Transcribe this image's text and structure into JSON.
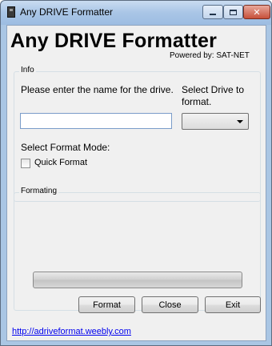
{
  "window": {
    "title": "Any DRIVE Formatter",
    "icon": "usb-drive-icon"
  },
  "header": {
    "app_title": "Any DRIVE Formatter",
    "powered_by": "Powered by: SAT-NET"
  },
  "info_group": {
    "legend": "Info",
    "name_label": "Please enter the name for the drive.",
    "name_value": "",
    "drive_label": "Select Drive to format.",
    "drive_selected": "",
    "format_mode_label": "Select Format Mode:",
    "quick_format_label": "Quick Format",
    "quick_format_checked": false
  },
  "formatting_group": {
    "legend": "Formating",
    "progress": 0
  },
  "buttons": {
    "format": "Format",
    "close": "Close",
    "exit": "Exit"
  },
  "footer": {
    "link": "http://adriveformat.weebly.com"
  },
  "colors": {
    "titlebar": "#a9c5e6",
    "client_bg": "#f0f0f0",
    "link": "#0000ee"
  }
}
